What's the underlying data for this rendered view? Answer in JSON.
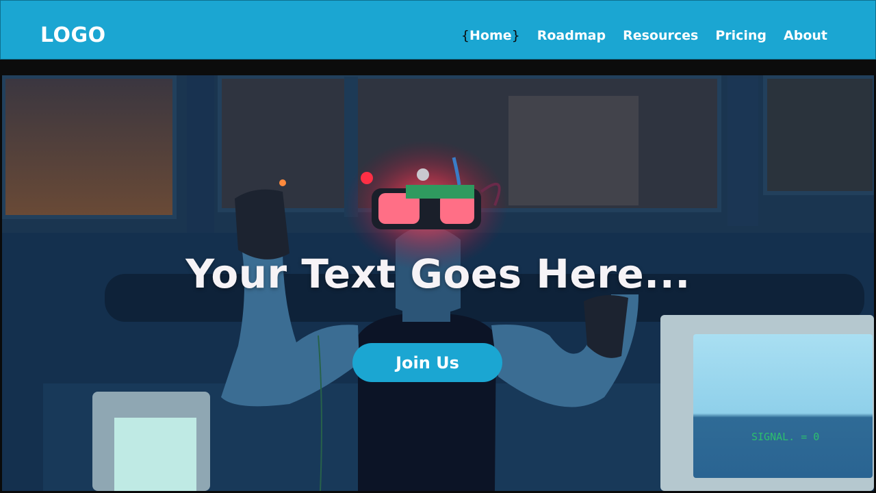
{
  "nav": {
    "logo": "LOGO",
    "open_brace": "{",
    "close_brace": "}",
    "links": [
      {
        "label": "Home",
        "active": true
      },
      {
        "label": "Roadmap"
      },
      {
        "label": "Resources"
      },
      {
        "label": "Pricing"
      },
      {
        "label": "About"
      }
    ]
  },
  "hero": {
    "headline": "Your Text Goes Here...",
    "cta_label": "Join Us",
    "monitor_text": "SIGNAL. = 0"
  },
  "colors": {
    "accent": "#1ba6d2",
    "text_light": "#ffffff",
    "headline": "#f6f3f6",
    "monitor_green": "#2dbf6e"
  }
}
